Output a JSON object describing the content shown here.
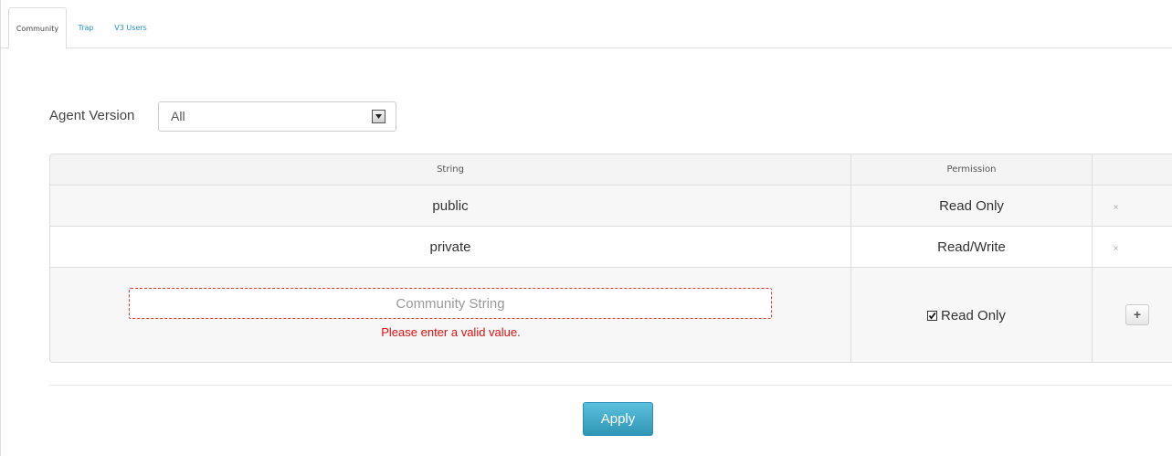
{
  "tabs": [
    {
      "label": "Community",
      "active": true
    },
    {
      "label": "Trap",
      "active": false
    },
    {
      "label": "V3 Users",
      "active": false
    }
  ],
  "agent_version": {
    "label": "Agent Version",
    "selected": "All"
  },
  "table": {
    "headers": {
      "string": "String",
      "permission": "Permission",
      "actions": ""
    },
    "rows": [
      {
        "string": "public",
        "permission": "Read Only",
        "delete_icon": "×"
      },
      {
        "string": "private",
        "permission": "Read/Write",
        "delete_icon": "×"
      }
    ],
    "new_entry": {
      "placeholder": "Community String",
      "value": "",
      "error": "Please enter a valid value.",
      "read_only_label": "Read Only",
      "read_only_checked": true,
      "add_icon": "+"
    }
  },
  "apply_label": "Apply",
  "colors": {
    "accent": "#2a8fc9",
    "error": "#e01010",
    "apply_button": "#49afcd"
  }
}
